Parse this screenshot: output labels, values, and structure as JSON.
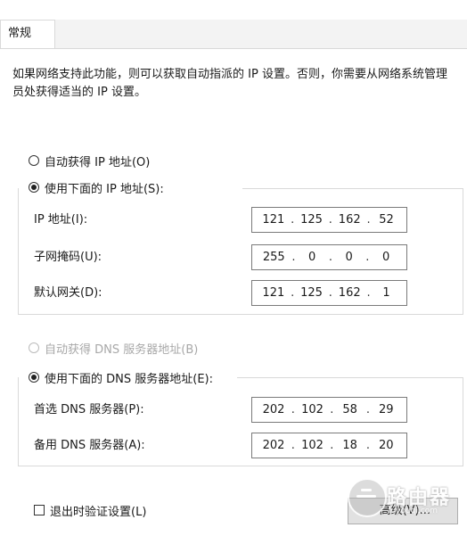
{
  "tabs": [
    {
      "label": "常规",
      "active": true
    }
  ],
  "description": "如果网络支持此功能，则可以获取自动指派的 IP 设置。否则，你需要从网络系统管理员处获得适当的 IP 设置。",
  "ip_mode": {
    "auto_label": "自动获得 IP 地址(O)",
    "auto_selected": false,
    "manual_label": "使用下面的 IP 地址(S):",
    "manual_selected": true
  },
  "ip_fields": [
    {
      "label": "IP 地址(I):",
      "octets": [
        "121",
        "125",
        "162",
        "52"
      ]
    },
    {
      "label": "子网掩码(U):",
      "octets": [
        "255",
        "0",
        "0",
        "0"
      ]
    },
    {
      "label": "默认网关(D):",
      "octets": [
        "121",
        "125",
        "162",
        "1"
      ]
    }
  ],
  "dns_mode": {
    "auto_label": "自动获得 DNS 服务器地址(B)",
    "auto_selected": false,
    "auto_disabled": true,
    "manual_label": "使用下面的 DNS 服务器地址(E):",
    "manual_selected": true
  },
  "dns_fields": [
    {
      "label": "首选 DNS 服务器(P):",
      "octets": [
        "202",
        "102",
        "58",
        "29"
      ]
    },
    {
      "label": "备用 DNS 服务器(A):",
      "octets": [
        "202",
        "102",
        "18",
        "20"
      ]
    }
  ],
  "validate_on_exit": {
    "label": "退出时验证设置(L)",
    "checked": false
  },
  "advanced_button": "高级(V)...",
  "watermark": {
    "text": "路由器",
    "sub": "luyouqi.com"
  }
}
